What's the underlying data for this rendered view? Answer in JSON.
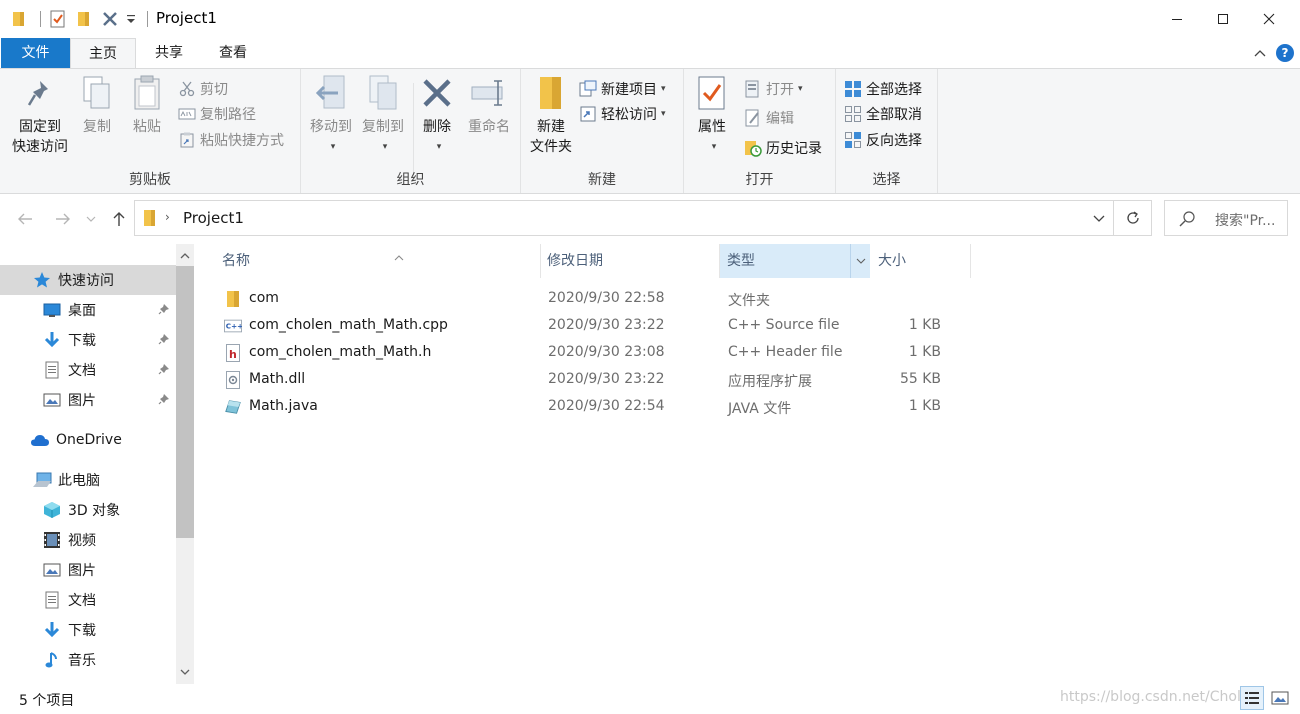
{
  "window": {
    "title": "Project1"
  },
  "tabs": {
    "file": "文件",
    "home": "主页",
    "share": "共享",
    "view": "查看"
  },
  "ribbon": {
    "clipboard": {
      "label": "剪贴板",
      "pin_line1": "固定到",
      "pin_line2": "快速访问",
      "copy": "复制",
      "paste": "粘贴",
      "cut": "剪切",
      "copy_path": "复制路径",
      "paste_shortcut": "粘贴快捷方式"
    },
    "organize": {
      "label": "组织",
      "move_to": "移动到",
      "copy_to": "复制到",
      "delete": "删除",
      "rename": "重命名"
    },
    "new": {
      "label": "新建",
      "new_folder_line1": "新建",
      "new_folder_line2": "文件夹",
      "new_item": "新建项目",
      "easy_access": "轻松访问"
    },
    "open": {
      "label": "打开",
      "properties": "属性",
      "open": "打开",
      "edit": "编辑",
      "history": "历史记录"
    },
    "select": {
      "label": "选择",
      "select_all": "全部选择",
      "select_none": "全部取消",
      "invert": "反向选择"
    }
  },
  "address": {
    "path": "Project1"
  },
  "search": {
    "placeholder": "搜索\"Pr..."
  },
  "nav": {
    "quick_access": "快速访问",
    "items": [
      {
        "label": "桌面",
        "icon": "desktop-icon",
        "pinned": true
      },
      {
        "label": "下载",
        "icon": "download-icon",
        "pinned": true
      },
      {
        "label": "文档",
        "icon": "document-icon",
        "pinned": true
      },
      {
        "label": "图片",
        "icon": "picture-icon",
        "pinned": true
      }
    ],
    "onedrive": "OneDrive",
    "this_pc": "此电脑",
    "pc_items": [
      {
        "label": "3D 对象",
        "icon": "3d-objects-icon"
      },
      {
        "label": "视频",
        "icon": "video-icon"
      },
      {
        "label": "图片",
        "icon": "picture-icon"
      },
      {
        "label": "文档",
        "icon": "document-icon"
      },
      {
        "label": "下载",
        "icon": "download-icon"
      },
      {
        "label": "音乐",
        "icon": "music-icon"
      }
    ]
  },
  "columns": {
    "name": "名称",
    "date": "修改日期",
    "type": "类型",
    "size": "大小"
  },
  "files": [
    {
      "name": "com",
      "date": "2020/9/30 22:58",
      "type": "文件夹",
      "size": "",
      "icon": "folder-icon"
    },
    {
      "name": "com_cholen_math_Math.cpp",
      "date": "2020/9/30 23:22",
      "type": "C++ Source file",
      "size": "1 KB",
      "icon": "cpp-file-icon"
    },
    {
      "name": "com_cholen_math_Math.h",
      "date": "2020/9/30 23:08",
      "type": "C++ Header file",
      "size": "1 KB",
      "icon": "header-file-icon"
    },
    {
      "name": "Math.dll",
      "date": "2020/9/30 23:22",
      "type": "应用程序扩展",
      "size": "55 KB",
      "icon": "dll-file-icon"
    },
    {
      "name": "Math.java",
      "date": "2020/9/30 22:54",
      "type": "JAVA 文件",
      "size": "1 KB",
      "icon": "java-file-icon"
    }
  ],
  "status": {
    "count": "5 个项目",
    "watermark": "https://blog.csdn.net/Cholen"
  },
  "colors": {
    "accent": "#1979ca",
    "folder": "#f2c34a",
    "selected_nav": "#d9d9d9",
    "sorted_header": "#d9ebf9"
  }
}
